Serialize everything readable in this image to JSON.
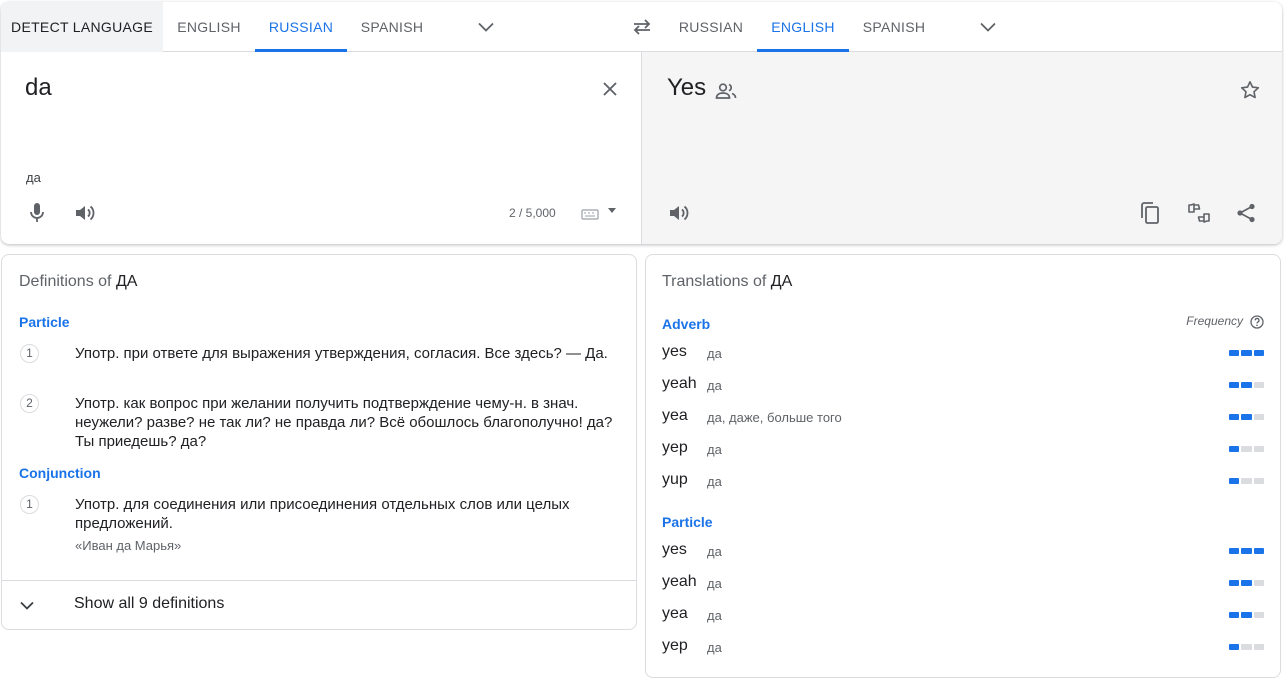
{
  "source_langs": {
    "tabs": [
      "DETECT LANGUAGE",
      "ENGLISH",
      "RUSSIAN",
      "SPANISH"
    ],
    "active": "RUSSIAN"
  },
  "target_langs": {
    "tabs": [
      "RUSSIAN",
      "ENGLISH",
      "SPANISH"
    ],
    "active": "ENGLISH"
  },
  "source": {
    "text": "da",
    "transliteration": "да",
    "char_count": "2 / 5,000"
  },
  "target": {
    "text": "Yes"
  },
  "definitions": {
    "title_prefix": "Definitions of",
    "title_word": "ДА",
    "groups": [
      {
        "pos": "Particle",
        "items": [
          {
            "num": "1",
            "text": "Употр. при ответе для выражения утверждения, согласия. Все здесь? — Да."
          },
          {
            "num": "2",
            "text": "Употр. как вопрос при желании получить подтверждение чему-н. в знач. неужели? разве? не так ли? не правда ли? Всё обошлось благополучно! да? Ты приедешь? да?"
          }
        ]
      },
      {
        "pos": "Conjunction",
        "items": [
          {
            "num": "1",
            "text": "Употр. для соединения или присоединения отдельных слов или целых предложений.",
            "example": "«Иван да Марья»"
          }
        ]
      }
    ],
    "show_all": "Show all 9 definitions"
  },
  "translations": {
    "title_prefix": "Translations of",
    "title_word": "ДА",
    "frequency_label": "Frequency",
    "groups": [
      {
        "pos": "Adverb",
        "rows": [
          {
            "word": "yes",
            "back": "да",
            "freq": 3
          },
          {
            "word": "yeah",
            "back": "да",
            "freq": 2
          },
          {
            "word": "yea",
            "back": "да, даже, больше того",
            "freq": 2
          },
          {
            "word": "yep",
            "back": "да",
            "freq": 1
          },
          {
            "word": "yup",
            "back": "да",
            "freq": 1
          }
        ]
      },
      {
        "pos": "Particle",
        "rows": [
          {
            "word": "yes",
            "back": "да",
            "freq": 3
          },
          {
            "word": "yeah",
            "back": "да",
            "freq": 2
          },
          {
            "word": "yea",
            "back": "да",
            "freq": 2
          },
          {
            "word": "yep",
            "back": "да",
            "freq": 1
          }
        ]
      }
    ]
  },
  "colors": {
    "accent": "#1a73e8",
    "muted": "#5f6368",
    "frequency_empty": "#dadce0"
  }
}
